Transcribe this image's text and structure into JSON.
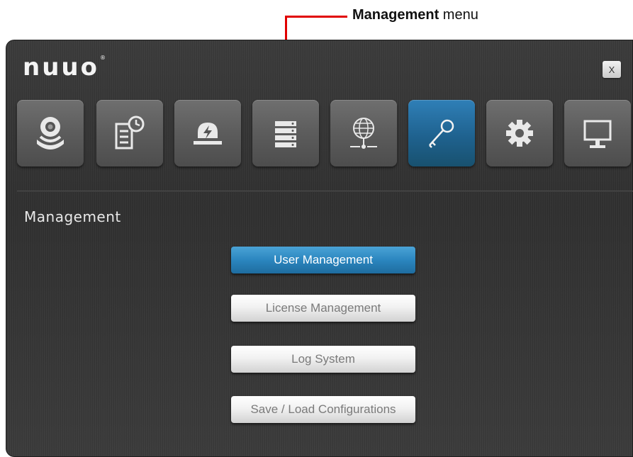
{
  "annotation": {
    "bold_text": "Management",
    "rest_text": " menu",
    "color": "#e10000"
  },
  "app": {
    "logo": "nuuo",
    "logo_mark": "®",
    "close_label": "X"
  },
  "tabs": [
    {
      "icon": "camera-icon",
      "active": false
    },
    {
      "icon": "schedule-document-icon",
      "active": false
    },
    {
      "icon": "alarm-event-icon",
      "active": false
    },
    {
      "icon": "storage-server-icon",
      "active": false
    },
    {
      "icon": "network-globe-icon",
      "active": false
    },
    {
      "icon": "key-icon",
      "active": true
    },
    {
      "icon": "gear-icon",
      "active": false
    },
    {
      "icon": "monitor-icon",
      "active": false
    }
  ],
  "section": {
    "title": "Management"
  },
  "menu": {
    "items": [
      {
        "label": "User Management",
        "selected": true
      },
      {
        "label": "License Management",
        "selected": false
      },
      {
        "label": "Log System",
        "selected": false
      },
      {
        "label": "Save / Load Configurations",
        "selected": false
      }
    ]
  },
  "colors": {
    "accent_blue": "#2b86bf",
    "window_bg": "#333333"
  }
}
